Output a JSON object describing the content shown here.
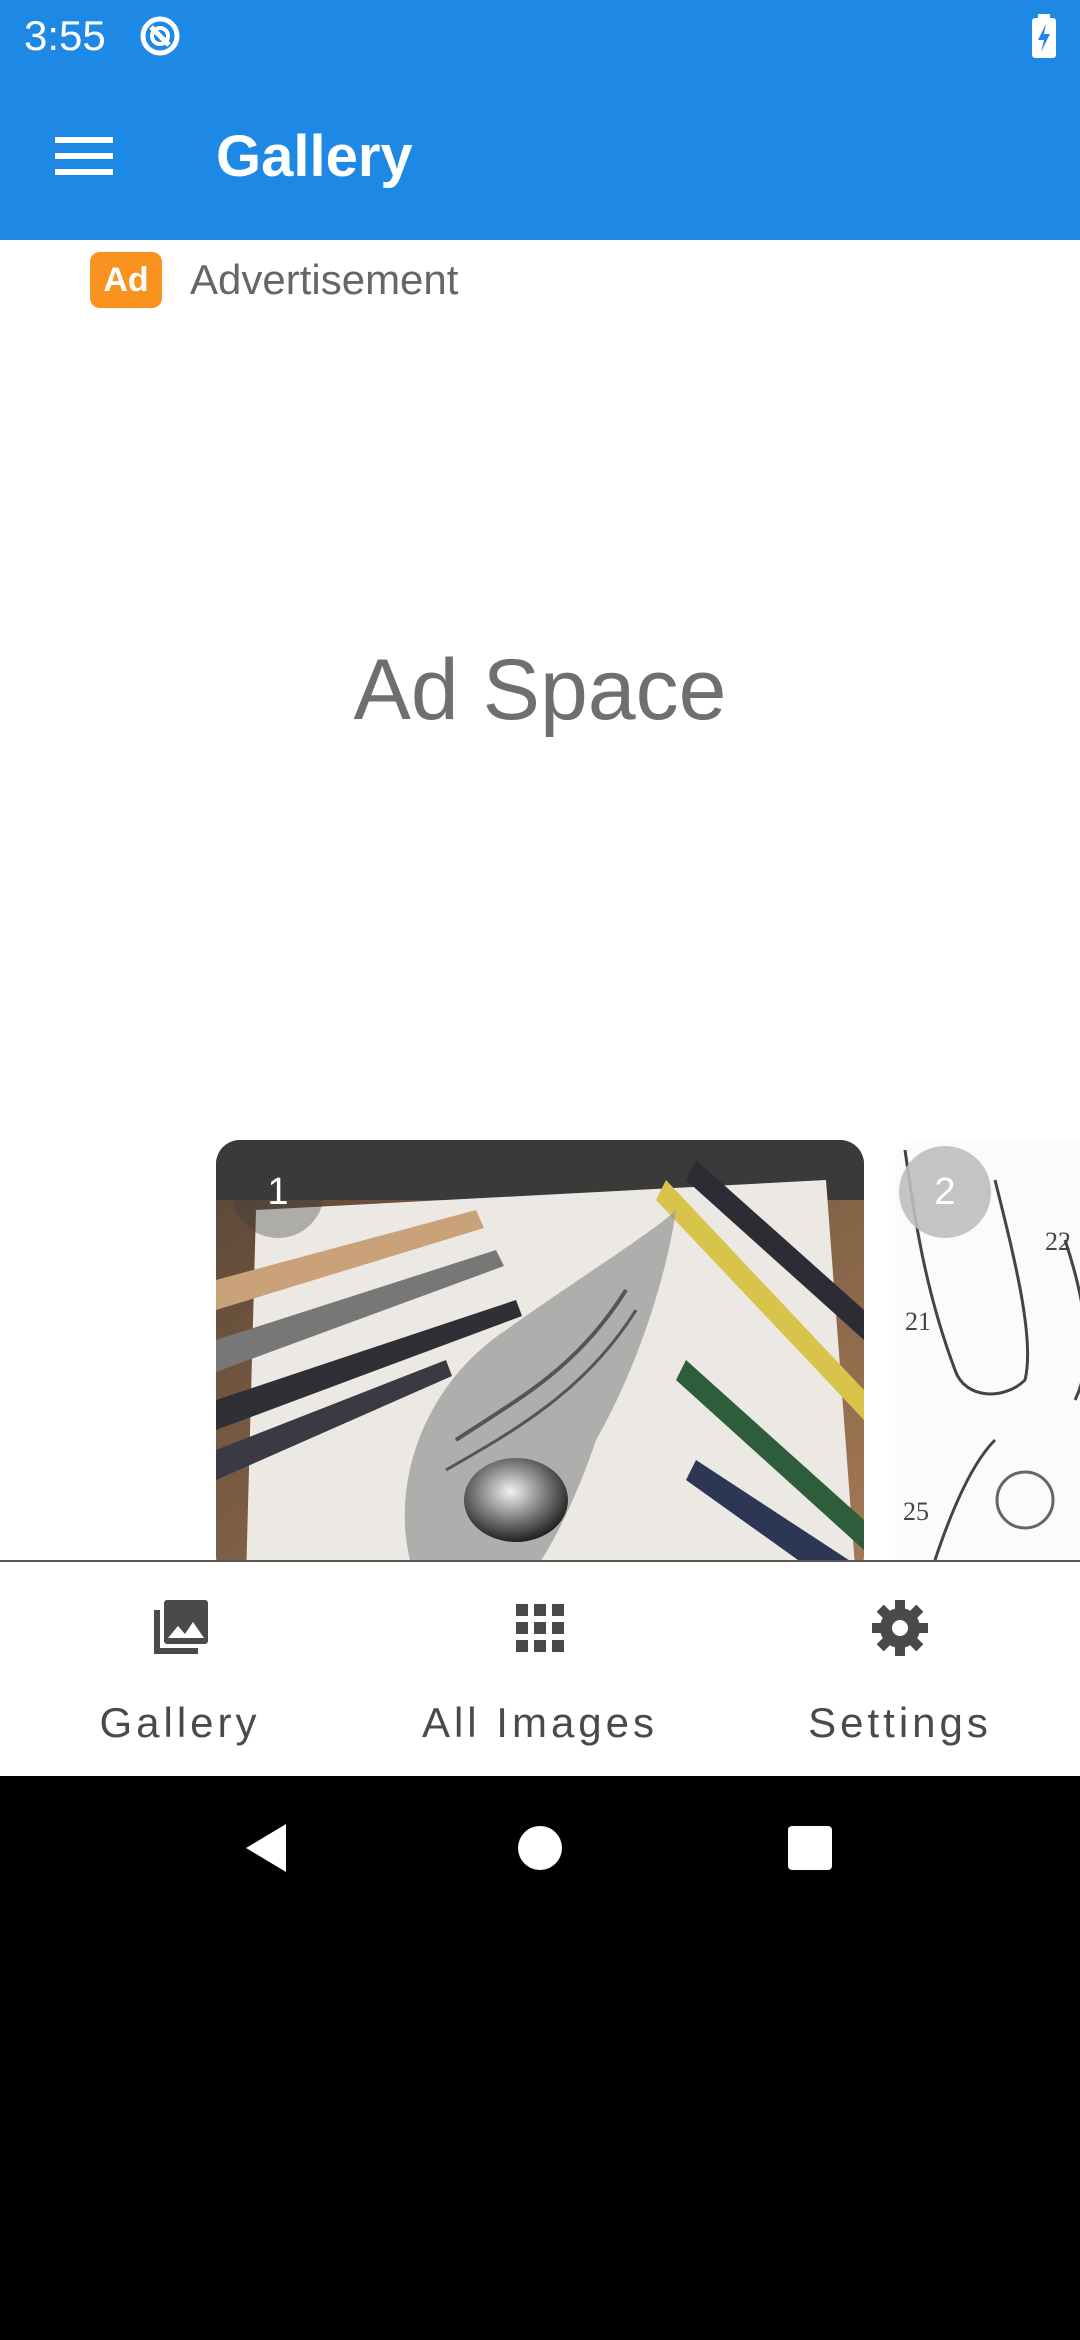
{
  "status_bar": {
    "time": "3:55",
    "app_icon": "circle-slash-icon",
    "battery_icon": "battery-charging-icon"
  },
  "app_bar": {
    "menu_icon": "hamburger-menu-icon",
    "title": "Gallery"
  },
  "ad": {
    "badge": "Ad",
    "label": "Advertisement",
    "space_text": "Ad Space"
  },
  "carousel": {
    "cards": [
      {
        "number": "1",
        "image": "pencil drawing of alien head with colored pencils"
      },
      {
        "number": "2",
        "image": "sketch of feet"
      }
    ]
  },
  "bottom_nav": {
    "items": [
      {
        "label": "Gallery",
        "icon": "photo-library-icon"
      },
      {
        "label": "All Images",
        "icon": "grid-icon"
      },
      {
        "label": "Settings",
        "icon": "gear-icon"
      }
    ]
  },
  "system_nav": {
    "back": "back-triangle-icon",
    "home": "home-circle-icon",
    "recents": "recents-square-icon"
  },
  "colors": {
    "app_bar": "#1e88e5",
    "ad_badge": "#f7931e",
    "nav_label": "#4a4a4a"
  }
}
